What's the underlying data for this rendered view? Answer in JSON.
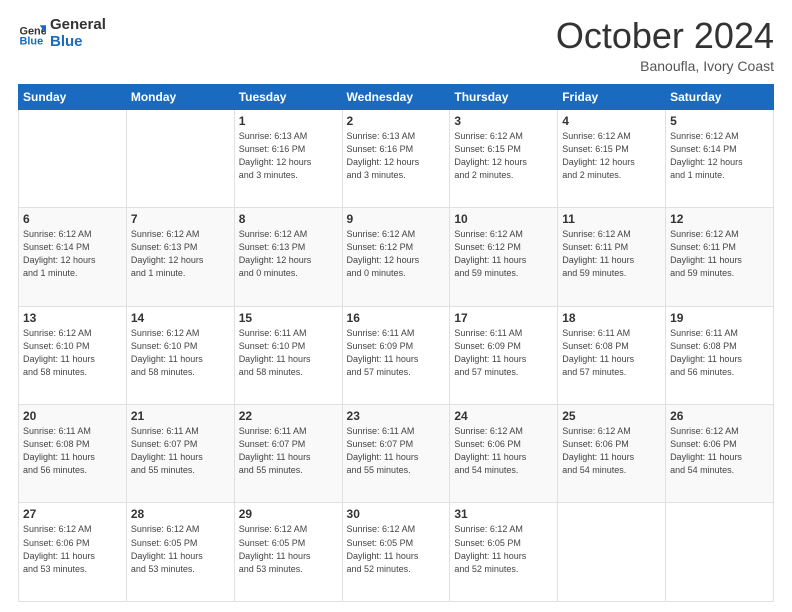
{
  "header": {
    "logo_line1": "General",
    "logo_line2": "Blue",
    "month": "October 2024",
    "location": "Banoufla, Ivory Coast"
  },
  "weekdays": [
    "Sunday",
    "Monday",
    "Tuesday",
    "Wednesday",
    "Thursday",
    "Friday",
    "Saturday"
  ],
  "weeks": [
    [
      {
        "day": "",
        "detail": ""
      },
      {
        "day": "",
        "detail": ""
      },
      {
        "day": "1",
        "detail": "Sunrise: 6:13 AM\nSunset: 6:16 PM\nDaylight: 12 hours\nand 3 minutes."
      },
      {
        "day": "2",
        "detail": "Sunrise: 6:13 AM\nSunset: 6:16 PM\nDaylight: 12 hours\nand 3 minutes."
      },
      {
        "day": "3",
        "detail": "Sunrise: 6:12 AM\nSunset: 6:15 PM\nDaylight: 12 hours\nand 2 minutes."
      },
      {
        "day": "4",
        "detail": "Sunrise: 6:12 AM\nSunset: 6:15 PM\nDaylight: 12 hours\nand 2 minutes."
      },
      {
        "day": "5",
        "detail": "Sunrise: 6:12 AM\nSunset: 6:14 PM\nDaylight: 12 hours\nand 1 minute."
      }
    ],
    [
      {
        "day": "6",
        "detail": "Sunrise: 6:12 AM\nSunset: 6:14 PM\nDaylight: 12 hours\nand 1 minute."
      },
      {
        "day": "7",
        "detail": "Sunrise: 6:12 AM\nSunset: 6:13 PM\nDaylight: 12 hours\nand 1 minute."
      },
      {
        "day": "8",
        "detail": "Sunrise: 6:12 AM\nSunset: 6:13 PM\nDaylight: 12 hours\nand 0 minutes."
      },
      {
        "day": "9",
        "detail": "Sunrise: 6:12 AM\nSunset: 6:12 PM\nDaylight: 12 hours\nand 0 minutes."
      },
      {
        "day": "10",
        "detail": "Sunrise: 6:12 AM\nSunset: 6:12 PM\nDaylight: 11 hours\nand 59 minutes."
      },
      {
        "day": "11",
        "detail": "Sunrise: 6:12 AM\nSunset: 6:11 PM\nDaylight: 11 hours\nand 59 minutes."
      },
      {
        "day": "12",
        "detail": "Sunrise: 6:12 AM\nSunset: 6:11 PM\nDaylight: 11 hours\nand 59 minutes."
      }
    ],
    [
      {
        "day": "13",
        "detail": "Sunrise: 6:12 AM\nSunset: 6:10 PM\nDaylight: 11 hours\nand 58 minutes."
      },
      {
        "day": "14",
        "detail": "Sunrise: 6:12 AM\nSunset: 6:10 PM\nDaylight: 11 hours\nand 58 minutes."
      },
      {
        "day": "15",
        "detail": "Sunrise: 6:11 AM\nSunset: 6:10 PM\nDaylight: 11 hours\nand 58 minutes."
      },
      {
        "day": "16",
        "detail": "Sunrise: 6:11 AM\nSunset: 6:09 PM\nDaylight: 11 hours\nand 57 minutes."
      },
      {
        "day": "17",
        "detail": "Sunrise: 6:11 AM\nSunset: 6:09 PM\nDaylight: 11 hours\nand 57 minutes."
      },
      {
        "day": "18",
        "detail": "Sunrise: 6:11 AM\nSunset: 6:08 PM\nDaylight: 11 hours\nand 57 minutes."
      },
      {
        "day": "19",
        "detail": "Sunrise: 6:11 AM\nSunset: 6:08 PM\nDaylight: 11 hours\nand 56 minutes."
      }
    ],
    [
      {
        "day": "20",
        "detail": "Sunrise: 6:11 AM\nSunset: 6:08 PM\nDaylight: 11 hours\nand 56 minutes."
      },
      {
        "day": "21",
        "detail": "Sunrise: 6:11 AM\nSunset: 6:07 PM\nDaylight: 11 hours\nand 55 minutes."
      },
      {
        "day": "22",
        "detail": "Sunrise: 6:11 AM\nSunset: 6:07 PM\nDaylight: 11 hours\nand 55 minutes."
      },
      {
        "day": "23",
        "detail": "Sunrise: 6:11 AM\nSunset: 6:07 PM\nDaylight: 11 hours\nand 55 minutes."
      },
      {
        "day": "24",
        "detail": "Sunrise: 6:12 AM\nSunset: 6:06 PM\nDaylight: 11 hours\nand 54 minutes."
      },
      {
        "day": "25",
        "detail": "Sunrise: 6:12 AM\nSunset: 6:06 PM\nDaylight: 11 hours\nand 54 minutes."
      },
      {
        "day": "26",
        "detail": "Sunrise: 6:12 AM\nSunset: 6:06 PM\nDaylight: 11 hours\nand 54 minutes."
      }
    ],
    [
      {
        "day": "27",
        "detail": "Sunrise: 6:12 AM\nSunset: 6:06 PM\nDaylight: 11 hours\nand 53 minutes."
      },
      {
        "day": "28",
        "detail": "Sunrise: 6:12 AM\nSunset: 6:05 PM\nDaylight: 11 hours\nand 53 minutes."
      },
      {
        "day": "29",
        "detail": "Sunrise: 6:12 AM\nSunset: 6:05 PM\nDaylight: 11 hours\nand 53 minutes."
      },
      {
        "day": "30",
        "detail": "Sunrise: 6:12 AM\nSunset: 6:05 PM\nDaylight: 11 hours\nand 52 minutes."
      },
      {
        "day": "31",
        "detail": "Sunrise: 6:12 AM\nSunset: 6:05 PM\nDaylight: 11 hours\nand 52 minutes."
      },
      {
        "day": "",
        "detail": ""
      },
      {
        "day": "",
        "detail": ""
      }
    ]
  ]
}
